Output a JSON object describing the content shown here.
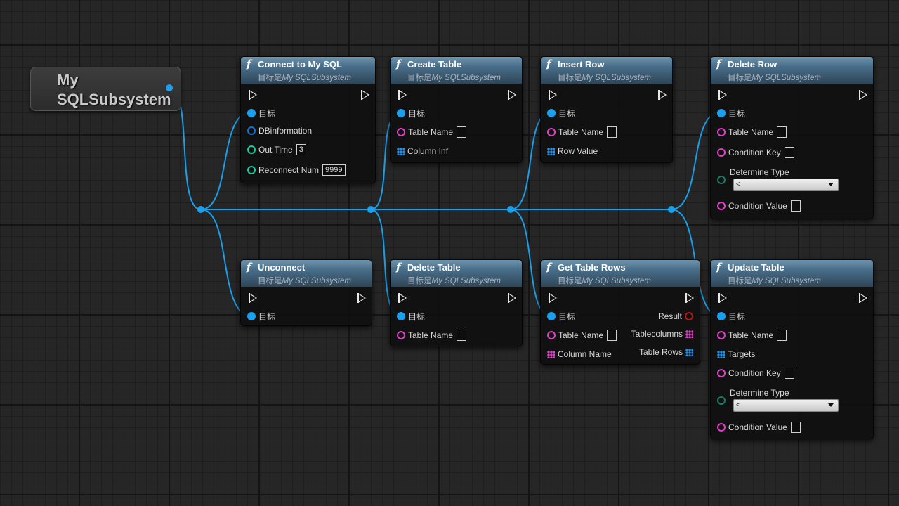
{
  "reference": {
    "label": "My SQLSubsystem"
  },
  "target_prefix": "目标是",
  "target_class": "My SQLSubsystem",
  "nodes": {
    "connect": {
      "title": "Connect to My SQL",
      "pins": {
        "target": "目标",
        "dbinfo": "DBinformation",
        "out_time": "Out Time",
        "out_time_value": "3",
        "reconnect": "Reconnect Num",
        "reconnect_value": "9999"
      }
    },
    "create_table": {
      "title": "Create Table",
      "pins": {
        "target": "目标",
        "table_name": "Table Name",
        "column_inf": "Column Inf"
      }
    },
    "insert_row": {
      "title": "Insert Row",
      "pins": {
        "target": "目标",
        "table_name": "Table Name",
        "row_value": "Row Value"
      }
    },
    "delete_row": {
      "title": "Delete Row",
      "pins": {
        "target": "目标",
        "table_name": "Table Name",
        "condition_key": "Condition Key",
        "determine_type": "Determine Type",
        "determine_value": "<",
        "condition_value": "Condition Value"
      }
    },
    "unconnect": {
      "title": "Unconnect",
      "pins": {
        "target": "目标"
      }
    },
    "delete_table": {
      "title": "Delete Table",
      "pins": {
        "target": "目标",
        "table_name": "Table Name"
      }
    },
    "get_table_rows": {
      "title": "Get Table Rows",
      "pins": {
        "target": "目标",
        "table_name": "Table Name",
        "column_name": "Column Name",
        "result": "Result",
        "tablecolumns": "Tablecolumns",
        "table_rows": "Table Rows"
      }
    },
    "update_table": {
      "title": "Update Table",
      "pins": {
        "target": "目标",
        "table_name": "Table Name",
        "targets": "Targets",
        "condition_key": "Condition Key",
        "determine_type": "Determine Type",
        "determine_value": "<",
        "condition_value": "Condition Value"
      }
    }
  },
  "colors": {
    "object_pin": "#1aa0ef",
    "string_pin": "#e040c8",
    "int_pin": "#1fc8a0",
    "bool_pin": "#b21818",
    "node_header": "#4a6f8a"
  }
}
